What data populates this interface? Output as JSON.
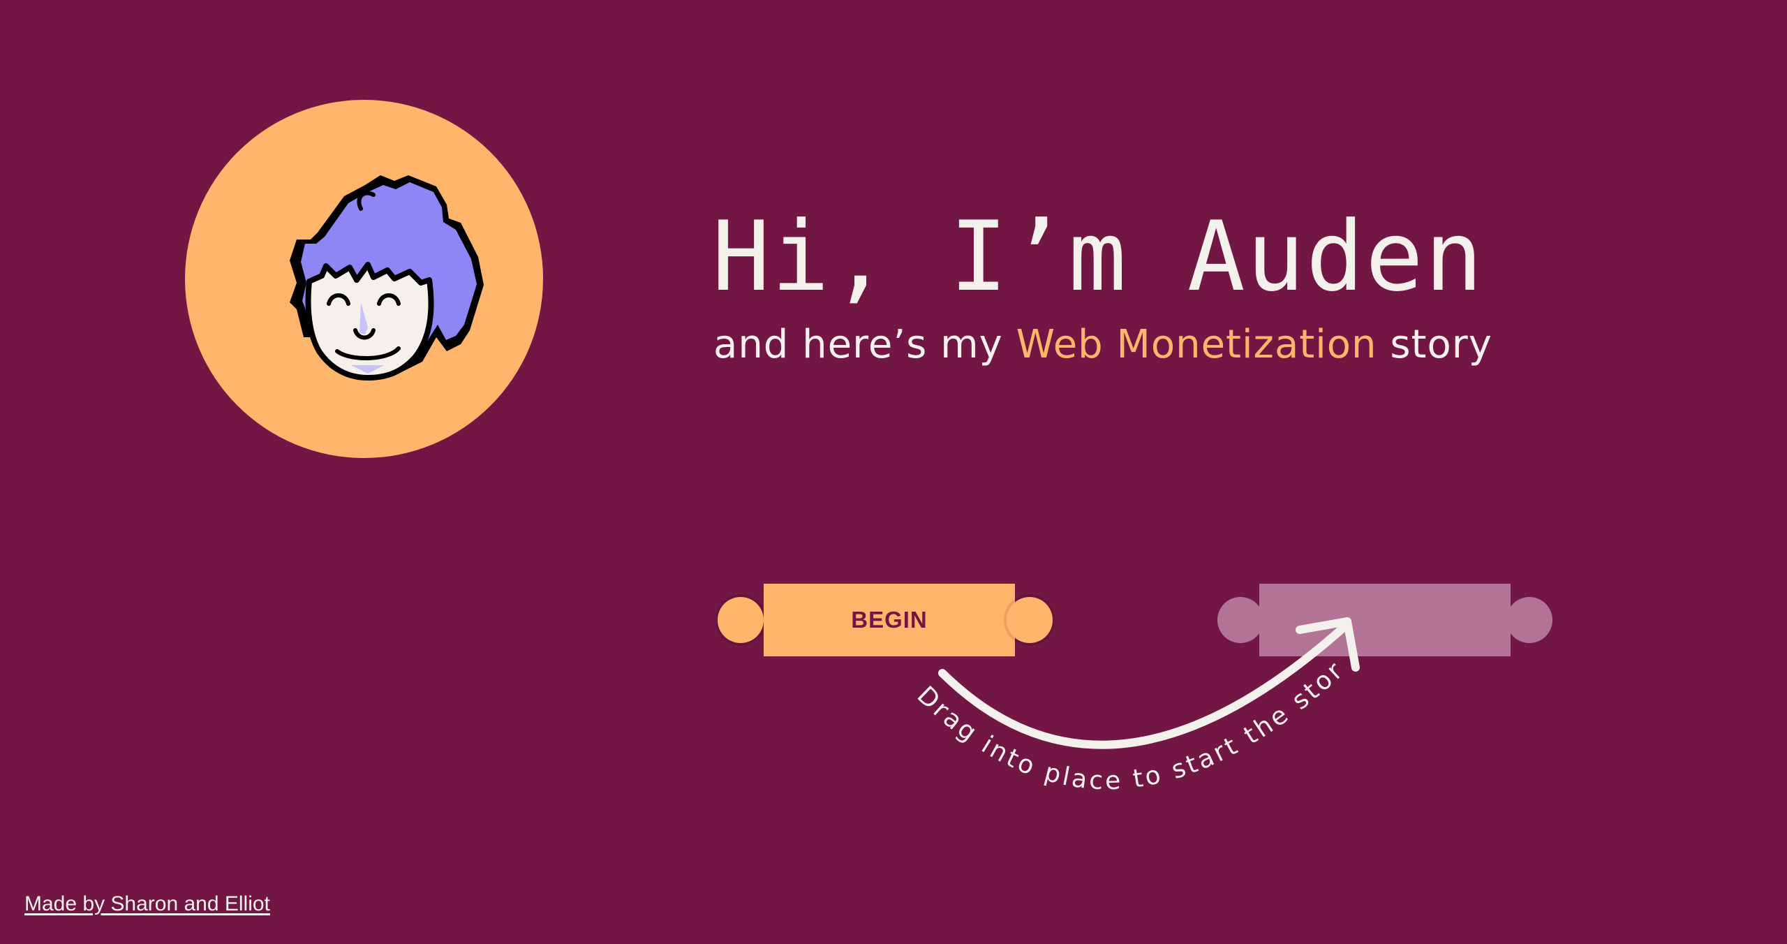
{
  "hero": {
    "title": "Hi, I’m Auden",
    "subtitle_before": "and here’s my ",
    "subtitle_highlight": "Web Monetization",
    "subtitle_after": " story"
  },
  "story_start": {
    "begin_label": "BEGIN",
    "hint": "Drag into place to start the story"
  },
  "footer": {
    "credit_link": "Made by Sharon and Elliot"
  },
  "colors": {
    "background": "#721744",
    "accent_orange": "#ffb56b",
    "hair_purple": "#8f86f5",
    "text_light": "#f4f1ec",
    "drop_slot": "#b27395"
  },
  "icons": {
    "avatar": "auden-face-icon",
    "hint_arrow": "curved-arrow-icon"
  }
}
